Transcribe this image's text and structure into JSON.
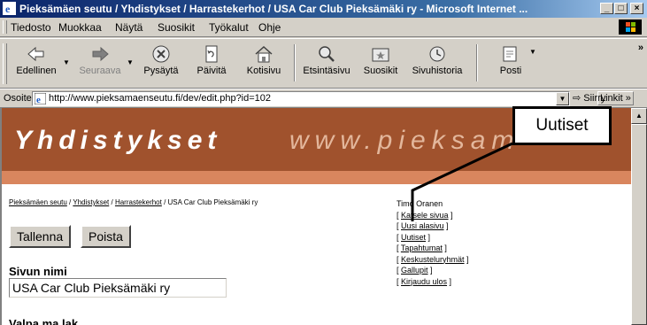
{
  "window": {
    "title": "Pieksämäen seutu / Yhdistykset / Harrastekerhot / USA Car Club Pieksämäki ry - Microsoft Internet ...",
    "minimize": "_",
    "maximize": "□",
    "close": "×"
  },
  "menu": {
    "items": [
      "Tiedosto",
      "Muokkaa",
      "Näytä",
      "Suosikit",
      "Työkalut",
      "Ohje"
    ]
  },
  "toolbar": {
    "back": "Edellinen",
    "forward": "Seuraava",
    "stop": "Pysäytä",
    "refresh": "Päivitä",
    "home": "Kotisivu",
    "search": "Etsintäsivu",
    "favorites": "Suosikit",
    "history": "Sivuhistoria",
    "mail": "Posti",
    "more": "»"
  },
  "address": {
    "label": "Osoite",
    "url": "http://www.pieksamaenseutu.fi/dev/edit.php?id=102",
    "go": "Siirry",
    "links": "Linkit »"
  },
  "banner": {
    "title": "Yhdistykset",
    "url_text": "www.pieksam"
  },
  "breadcrumb": {
    "links": [
      "Pieksämäen seutu",
      "Yhdistykset",
      "Harrastekerhot"
    ],
    "separator": " / ",
    "current": "USA Car Club Pieksämäki ry"
  },
  "form": {
    "save_button": "Tallenna",
    "delete_button": "Poista",
    "page_name_label": "Sivun nimi",
    "page_name_value": "USA Car Club Pieksämäki ry",
    "next_label": "Valpa ma lak"
  },
  "user_panel": {
    "user_name": "Timo Oranen",
    "links": [
      "Katsele sivua",
      "Uusi alasivu",
      "Uutiset",
      "Tapahtumat",
      "Keskusteluryhmät",
      "Gallupit",
      "Kirjaudu ulos"
    ]
  },
  "callout": {
    "label": "Uutiset"
  },
  "colors": {
    "titlebar": "#0a246a",
    "banner": "#a0522d",
    "stripe": "#d9865e",
    "chrome": "#d4d0c8"
  }
}
